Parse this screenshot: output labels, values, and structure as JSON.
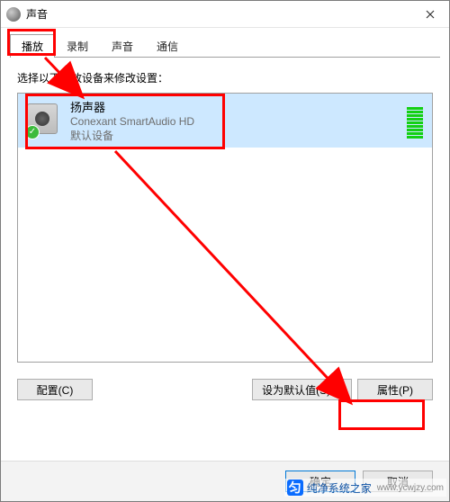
{
  "window": {
    "title": "声音"
  },
  "tabs": {
    "items": [
      {
        "label": "播放",
        "active": true
      },
      {
        "label": "录制",
        "active": false
      },
      {
        "label": "声音",
        "active": false
      },
      {
        "label": "通信",
        "active": false
      }
    ]
  },
  "content": {
    "instruction": "选择以下播放设备来修改设置：",
    "devices": [
      {
        "name": "扬声器",
        "driver": "Conexant SmartAudio HD",
        "status_text": "默认设备",
        "icon": "speaker-device-icon",
        "status_icon": "check-icon",
        "selected": true
      }
    ],
    "buttons": {
      "configure": "配置(C)",
      "set_default": "设为默认值(S)",
      "properties": "属性(P)"
    }
  },
  "dialog_buttons": {
    "ok": "确定",
    "cancel": "取消"
  },
  "annotations": {
    "highlight_tab": true,
    "highlight_device": true,
    "highlight_properties": true,
    "arrow_from_device_to_properties": true
  },
  "watermark": {
    "name": "纯净系统之家",
    "url": "www.ycwjzy.com"
  }
}
